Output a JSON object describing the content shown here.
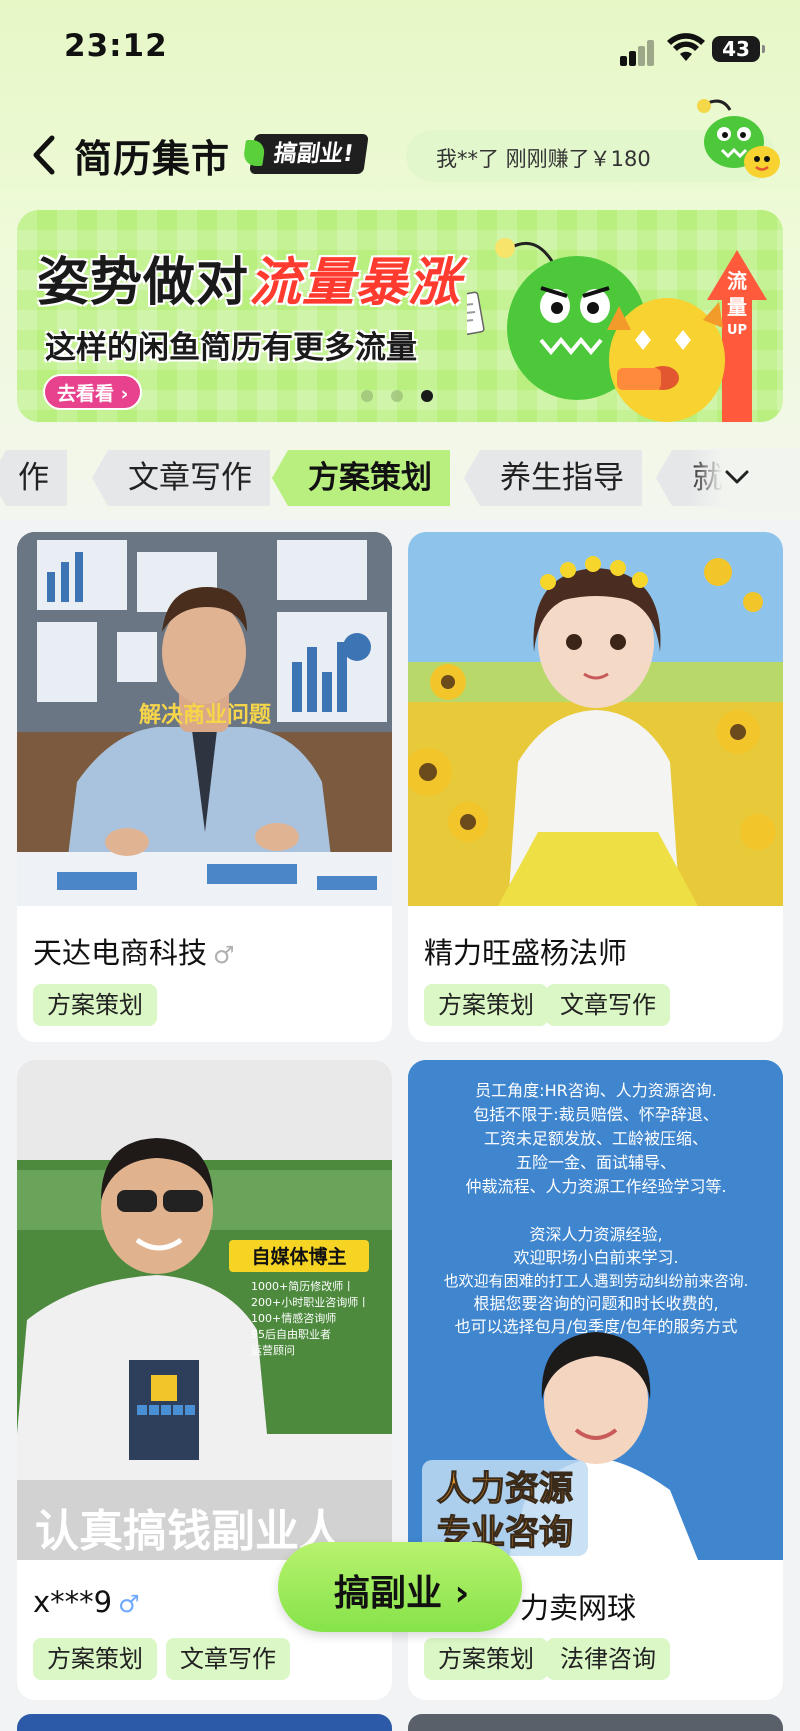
{
  "status_bar": {
    "time": "23:12",
    "battery": "43"
  },
  "header": {
    "title": "简历集市",
    "badge": "搞副业!",
    "ticker": "我**了 刚刚赚了￥180"
  },
  "banner": {
    "headline_plain": "姿势做对",
    "headline_highlight": "流量暴涨",
    "subtitle": "这样的闲鱼简历有更多流量",
    "button": "去看看 ›",
    "side_label": "流量UP",
    "page_dots": 3,
    "active_dot": 3
  },
  "tabs": [
    {
      "label": "作",
      "active": false
    },
    {
      "label": "文章写作",
      "active": false
    },
    {
      "label": "方案策划",
      "active": true
    },
    {
      "label": "养生指导",
      "active": false
    },
    {
      "label": "就",
      "active": false
    }
  ],
  "cards": [
    {
      "image_caption": "解决商业问题",
      "name": "天达电商科技",
      "gender": "♂",
      "tags": [
        "方案策划"
      ]
    },
    {
      "image_caption": "",
      "name": "精力旺盛杨法师",
      "gender": "",
      "tags": [
        "方案策划",
        "文章写作"
      ]
    },
    {
      "image_caption": "认真搞钱副业人",
      "image_badge": "自媒体博主",
      "image_lines": [
        "1000+简历修改师丨",
        "200+小时职业咨询师丨",
        "100+情感咨询师",
        "95后自由职业者",
        "运营顾问"
      ],
      "name": "x***9",
      "gender": "♂",
      "tags": [
        "方案策划",
        "文章写作"
      ]
    },
    {
      "image_text": [
        "员工角度:HR咨询、人力资源咨询.",
        "包括不限于:裁员赔偿、怀孕辞退、",
        "工资未足额发放、工龄被压缩、",
        "五险一金、面试辅导、",
        "仲裁流程、人力资源工作经验学习等.",
        "",
        "资深人力资源经验,",
        "欢迎职场小白前来学习.",
        "也欢迎有困难的打工人遇到劳动纠纷前来咨询.",
        "根据您要咨询的问题和时长收费的,",
        "也可以选择包月/包季度/包年的服务方式"
      ],
      "image_caption": [
        "人力资源",
        "专业咨询"
      ],
      "name": "力卖网球",
      "gender": "",
      "tags": [
        "方案策划",
        "法律咨询"
      ]
    }
  ],
  "cta": {
    "label": "搞副业 ›"
  }
}
